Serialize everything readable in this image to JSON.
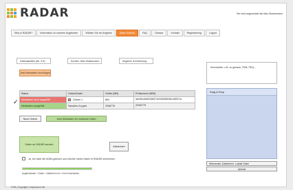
{
  "brand": {
    "name": "RADAR",
    "logo_colors": [
      "#f5a623",
      "#8cc63f",
      "#f5a623",
      "#8cc63f",
      "#f28b3b",
      "#4aa3df",
      "#f28b3b",
      "#8cc63f",
      "#f5a623"
    ]
  },
  "header": {
    "login_info": "Sie sind angemeldet als Max Mustermann"
  },
  "nav": {
    "items": [
      {
        "label": "Why is RADAR?",
        "active": false
      },
      {
        "label": "Information zu unseren Angeboten",
        "active": false
      },
      {
        "label": "Wählen Sie ein Angebot",
        "active": false
      },
      {
        "label": "Daten Ansicht",
        "active": true
      },
      {
        "label": "FAQ",
        "active": false
      },
      {
        "label": "Glossar",
        "active": false
      },
      {
        "label": "Kontakt",
        "active": false
      },
      {
        "label": "Registrierung",
        "active": false
      },
      {
        "label": "Logout",
        "active": false
      }
    ]
  },
  "form": {
    "field_title": "Datensatztitel (Ab. 5.5)",
    "field_creator": "Kurator: Max Mustermann",
    "field_type": "Angebot: Archivierung",
    "add_metadata_button": "Jetzt Metadaten hinzufügen",
    "keywords_box": "Kennwörter, z.B. zu genaue, PDB, PEQ..."
  },
  "table": {
    "headers": [
      "Status",
      "Ordner/Datei",
      "Größe (MB)",
      "Prüfsumme (MD5)"
    ],
    "rows": [
      {
        "status": "Metadaten nicht ausgefüllt",
        "item": "Ordner 1",
        "size": "800",
        "checksum": "a9d8b4b89388374e56939988c48637a",
        "status_type": "red"
      },
      {
        "status": "Metadaten ausgefüllt",
        "item": "Samples-Xq.geiz",
        "size": "2266776",
        "checksum": "2266776",
        "status_type": "green"
      }
    ]
  },
  "actions": {
    "new_folder": "Neue Ordner",
    "add_metadata_selected": "Jetzt Metadaten für markierte Daten",
    "submit_radar": "Daten an RADAR senden",
    "cancel": "Abbrechen",
    "agree_text": "Ja, ich habe die AGBs gelesen und möchte meine Daten in RADAR archivieren",
    "upload": "Upload"
  },
  "dropzone": {
    "title": "Drag & Drop"
  },
  "sidebar": {
    "file_chooser": "Wennmals: Dateien/ev. Lokale Datei"
  },
  "progress": {
    "value": 1.0,
    "steps": "Angebotswahl > Daten > Aktivieren mit > Ihrem Nachweise"
  },
  "footer": {
    "text": "FGB | Copyright | Impressum etc."
  }
}
